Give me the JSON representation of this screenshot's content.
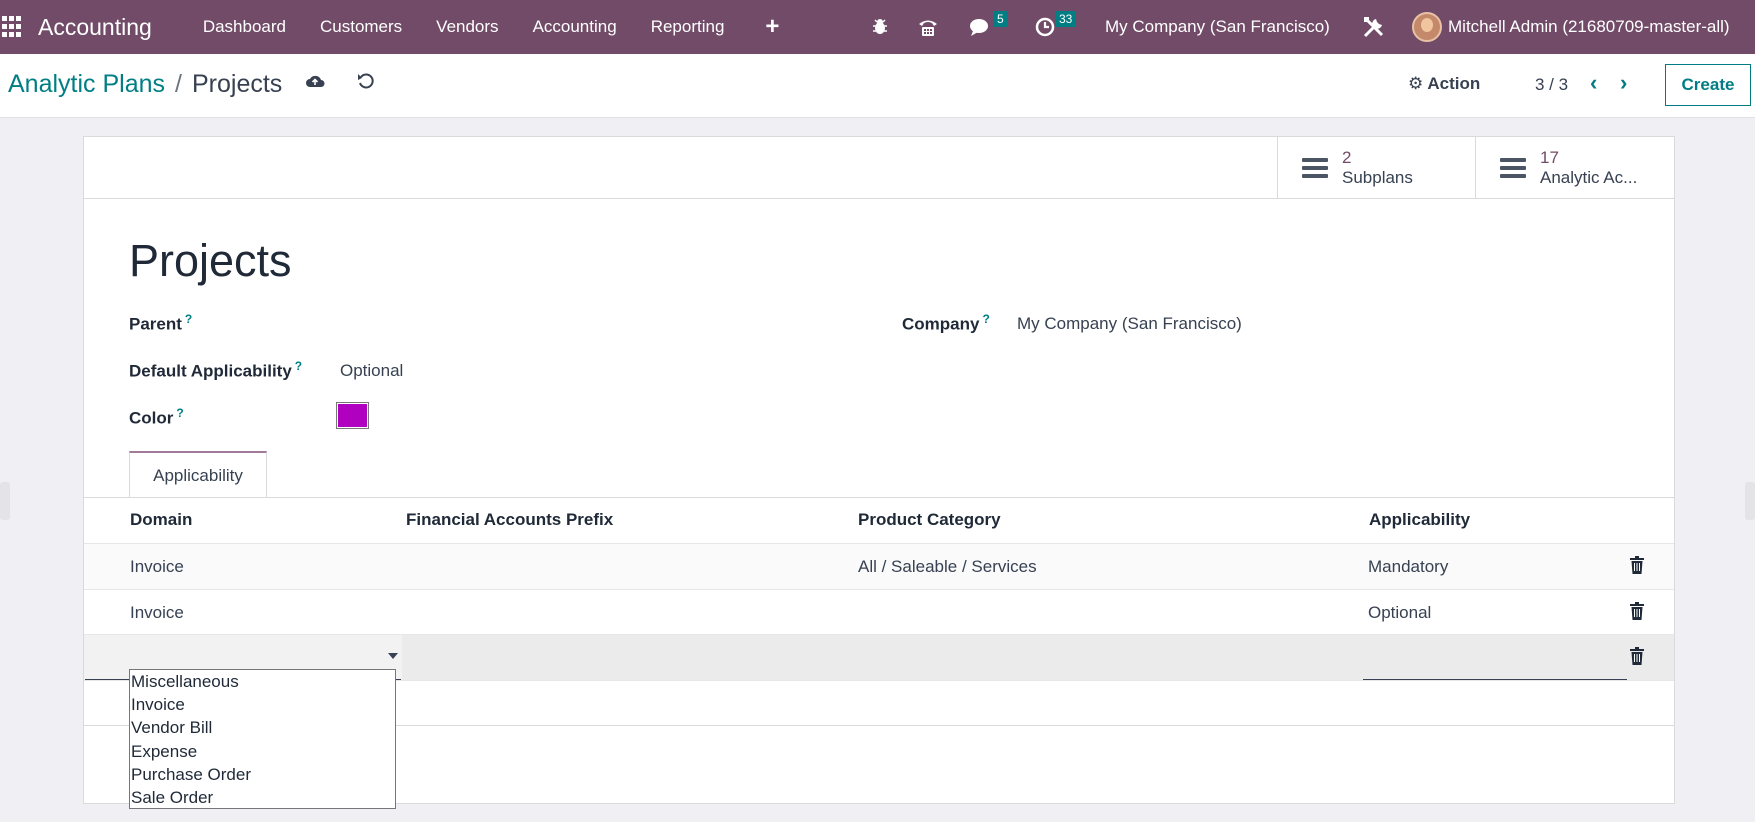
{
  "navbar": {
    "app_name": "Accounting",
    "menu": [
      "Dashboard",
      "Customers",
      "Vendors",
      "Accounting",
      "Reporting"
    ],
    "plus": "+",
    "messages_count": "5",
    "activities_count": "33",
    "company": "My Company (San Francisco)",
    "user": "Mitchell Admin (21680709-master-all)"
  },
  "breadcrumb": {
    "parent": "Analytic Plans",
    "separator": "/",
    "current": "Projects"
  },
  "control": {
    "action_label": "Action",
    "pager": "3 / 3",
    "create_label": "Create"
  },
  "smart_buttons": [
    {
      "value": "2",
      "label": "Subplans",
      "icon": "list-icon"
    },
    {
      "value": "17",
      "label": "Analytic Ac...",
      "icon": "list-icon"
    }
  ],
  "form": {
    "title": "Projects",
    "parent_label": "Parent",
    "parent_value": "",
    "company_label": "Company",
    "company_value": "My Company (San Francisco)",
    "applicability_label": "Default Applicability",
    "applicability_value": "Optional",
    "color_label": "Color",
    "color_value": "#b000c0",
    "help_mark": "?"
  },
  "tab": {
    "label": "Applicability"
  },
  "table": {
    "columns": [
      "Domain",
      "Financial Accounts Prefix",
      "Product Category",
      "Applicability"
    ],
    "rows": [
      {
        "domain": "Invoice",
        "prefix": "",
        "category": "All / Saleable / Services",
        "applicability": "Mandatory"
      },
      {
        "domain": "Invoice",
        "prefix": "",
        "category": "",
        "applicability": "Optional"
      }
    ]
  },
  "dropdown": {
    "options": [
      "Miscellaneous",
      "Invoice",
      "Vendor Bill",
      "Expense",
      "Purchase Order",
      "Sale Order"
    ]
  },
  "colors": {
    "navbar": "#714B67",
    "accent": "#017e84"
  }
}
